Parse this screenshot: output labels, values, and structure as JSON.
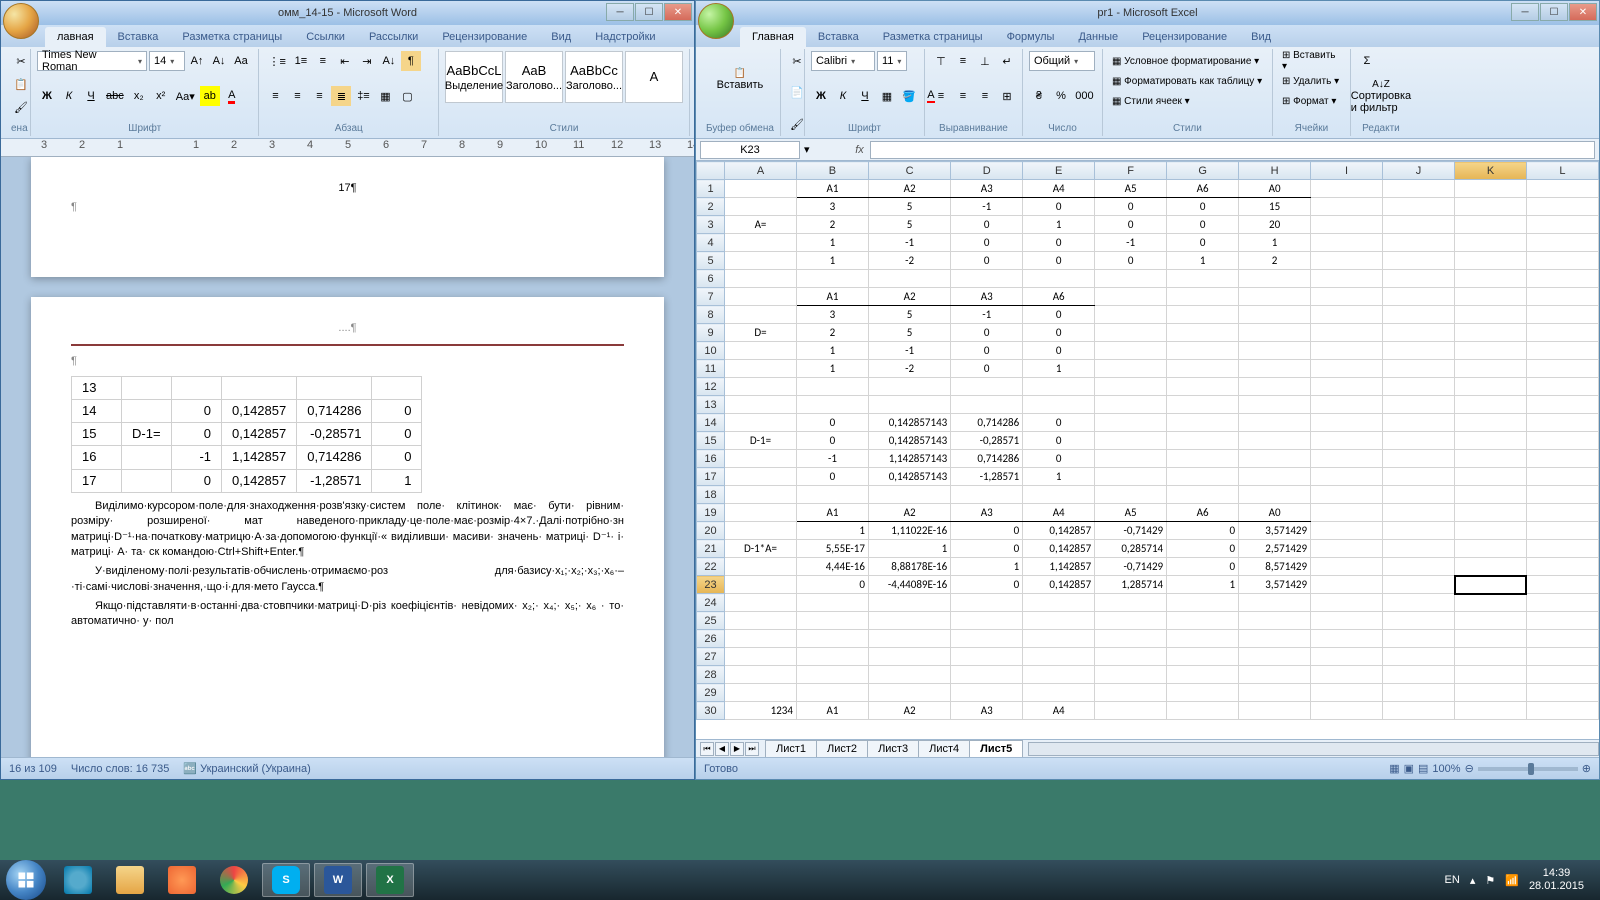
{
  "word": {
    "title": "омм_14-15 - Microsoft Word",
    "tabs": [
      "лавная",
      "Вставка",
      "Разметка страницы",
      "Ссылки",
      "Рассылки",
      "Рецензирование",
      "Вид",
      "Надстройки"
    ],
    "font_name": "Times New Roman",
    "font_size": "14",
    "groups": {
      "font": "Шрифт",
      "para": "Абзац",
      "styles": "Стили",
      "clip": "ена"
    },
    "style_boxes": [
      {
        "samp": "AaBbCcL",
        "label": "Выделение"
      },
      {
        "samp": "AaB",
        "label": "Заголово..."
      },
      {
        "samp": "AaBbCc",
        "label": "Заголово..."
      },
      {
        "samp": "A",
        "label": ""
      }
    ],
    "page_num": "17¶",
    "doc_table": {
      "rows": [
        [
          "13",
          "",
          "",
          "",
          "",
          ""
        ],
        [
          "14",
          "",
          "0",
          "0,142857",
          "0,714286",
          "0"
        ],
        [
          "15",
          "D-1=",
          "0",
          "0,142857",
          "-0,28571",
          "0"
        ],
        [
          "16",
          "",
          "-1",
          "1,142857",
          "0,714286",
          "0"
        ],
        [
          "17",
          "",
          "0",
          "0,142857",
          "-1,28571",
          "1"
        ]
      ]
    },
    "para1": "Виділимо·курсором·поле·для·знаходження·розв'язку·систем поле· клітинок· має· бути· рівним· розміру· розширеної· мат наведеного·прикладу·це·поле·має·розмір·4×7.·Далі·потрібно·зн матриці·D⁻¹·на·початкову·матрицю·A·за·допомогою·функції·« виділивши· масиви· значень· матриці· D⁻¹· і· матриці· A· та· ск командою·Ctrl+Shift+Enter.¶",
    "para2": "У·виділеному·полі·результатів·обчислень·отримаємо·роз для·базису·x₁;·x₂;·x₃;·x₆·–·ті·самі·числові·значення,·що·і·для·мето Гаусса.¶",
    "para3": "Якщо·підставляти·в·останні·два·стовпчики·матриці·D·різ коефіцієнтів· невідомих· x₂;· x₄;· x₅;· x₆ · то· автоматично· у· пол",
    "status": {
      "page": "16 из 109",
      "words": "Число слов: 16 735",
      "lang": "Украинский (Украина)"
    },
    "dots_line": "....¶"
  },
  "excel": {
    "title": "pr1 - Microsoft Excel",
    "tabs": [
      "Главная",
      "Вставка",
      "Разметка страницы",
      "Формулы",
      "Данные",
      "Рецензирование",
      "Вид"
    ],
    "font_name": "Calibri",
    "font_size": "11",
    "groups": {
      "clip": "Буфер обмена",
      "font": "Шрифт",
      "align": "Выравнивание",
      "num": "Число",
      "styles": "Стили",
      "cells": "Ячейки",
      "edit": "Редакти"
    },
    "num_format": "Общий",
    "pct": "%",
    "thou": "000",
    "style_btns": [
      "Условное форматирование",
      "Форматировать как таблицу",
      "Стили ячеек"
    ],
    "cell_btns": [
      "Вставить",
      "Удалить",
      "Формат"
    ],
    "sort_label": "Сортировка и фильтр",
    "paste": "Вставить",
    "namebox": "K23",
    "cols": [
      "A",
      "B",
      "C",
      "D",
      "E",
      "F",
      "G",
      "H",
      "I",
      "J",
      "K",
      "L"
    ],
    "sel_col": "K",
    "sel_row": 23,
    "rows": [
      {
        "r": 1,
        "cells": [
          "",
          "A1",
          "A2",
          "A3",
          "A4",
          "A5",
          "A6",
          "A0"
        ],
        "align": [
          "",
          "c",
          "c",
          "c",
          "c",
          "c",
          "c",
          "c"
        ],
        "bb": [
          1,
          2,
          3,
          4,
          5,
          6,
          7
        ]
      },
      {
        "r": 2,
        "cells": [
          "",
          "3",
          "5",
          "-1",
          "0",
          "0",
          "0",
          "15"
        ],
        "align": [
          "",
          "c",
          "c",
          "c",
          "c",
          "c",
          "c",
          "c"
        ]
      },
      {
        "r": 3,
        "cells": [
          "A=",
          "2",
          "5",
          "0",
          "1",
          "0",
          "0",
          "20"
        ],
        "align": [
          "c",
          "c",
          "c",
          "c",
          "c",
          "c",
          "c",
          "c"
        ]
      },
      {
        "r": 4,
        "cells": [
          "",
          "1",
          "-1",
          "0",
          "0",
          "-1",
          "0",
          "1"
        ],
        "align": [
          "",
          "c",
          "c",
          "c",
          "c",
          "c",
          "c",
          "c"
        ]
      },
      {
        "r": 5,
        "cells": [
          "",
          "1",
          "-2",
          "0",
          "0",
          "0",
          "1",
          "2"
        ],
        "align": [
          "",
          "c",
          "c",
          "c",
          "c",
          "c",
          "c",
          "c"
        ]
      },
      {
        "r": 6,
        "cells": [
          "",
          "",
          "",
          "",
          "",
          "",
          "",
          ""
        ]
      },
      {
        "r": 7,
        "cells": [
          "",
          "A1",
          "A2",
          "A3",
          "A6",
          "",
          "",
          ""
        ],
        "align": [
          "",
          "c",
          "c",
          "c",
          "c"
        ],
        "bb": [
          1,
          2,
          3,
          4
        ]
      },
      {
        "r": 8,
        "cells": [
          "",
          "3",
          "5",
          "-1",
          "0",
          "",
          "",
          ""
        ],
        "align": [
          "",
          "c",
          "c",
          "c",
          "c"
        ]
      },
      {
        "r": 9,
        "cells": [
          "D=",
          "2",
          "5",
          "0",
          "0",
          "",
          "",
          ""
        ],
        "align": [
          "c",
          "c",
          "c",
          "c",
          "c"
        ]
      },
      {
        "r": 10,
        "cells": [
          "",
          "1",
          "-1",
          "0",
          "0",
          "",
          "",
          ""
        ],
        "align": [
          "",
          "c",
          "c",
          "c",
          "c"
        ]
      },
      {
        "r": 11,
        "cells": [
          "",
          "1",
          "-2",
          "0",
          "1",
          "",
          "",
          ""
        ],
        "align": [
          "",
          "c",
          "c",
          "c",
          "c"
        ]
      },
      {
        "r": 12,
        "cells": [
          "",
          "",
          "",
          "",
          "",
          "",
          "",
          ""
        ]
      },
      {
        "r": 13,
        "cells": [
          "",
          "",
          "",
          "",
          "",
          "",
          "",
          ""
        ]
      },
      {
        "r": 14,
        "cells": [
          "",
          "0",
          "0,142857143",
          "0,714286",
          "0",
          "",
          "",
          ""
        ],
        "align": [
          "",
          "c",
          "r",
          "r",
          "c"
        ]
      },
      {
        "r": 15,
        "cells": [
          "D-1=",
          "0",
          "0,142857143",
          "-0,28571",
          "0",
          "",
          "",
          ""
        ],
        "align": [
          "c",
          "c",
          "r",
          "r",
          "c"
        ]
      },
      {
        "r": 16,
        "cells": [
          "",
          "-1",
          "1,142857143",
          "0,714286",
          "0",
          "",
          "",
          ""
        ],
        "align": [
          "",
          "c",
          "r",
          "r",
          "c"
        ]
      },
      {
        "r": 17,
        "cells": [
          "",
          "0",
          "0,142857143",
          "-1,28571",
          "1",
          "",
          "",
          ""
        ],
        "align": [
          "",
          "c",
          "r",
          "r",
          "c"
        ]
      },
      {
        "r": 18,
        "cells": [
          "",
          "",
          "",
          "",
          "",
          "",
          "",
          ""
        ]
      },
      {
        "r": 19,
        "cells": [
          "",
          "A1",
          "A2",
          "A3",
          "A4",
          "A5",
          "A6",
          "A0"
        ],
        "align": [
          "",
          "c",
          "c",
          "c",
          "c",
          "c",
          "c",
          "c"
        ],
        "bb": [
          1,
          2,
          3,
          4,
          5,
          6,
          7
        ]
      },
      {
        "r": 20,
        "cells": [
          "",
          "1",
          "1,11022E-16",
          "0",
          "0,142857",
          "-0,71429",
          "0",
          "3,571429"
        ]
      },
      {
        "r": 21,
        "cells": [
          "D-1*A=",
          "5,55E-17",
          "1",
          "0",
          "0,142857",
          "0,285714",
          "0",
          "2,571429"
        ],
        "align": [
          "c"
        ]
      },
      {
        "r": 22,
        "cells": [
          "",
          "4,44E-16",
          "8,88178E-16",
          "1",
          "1,142857",
          "-0,71429",
          "0",
          "8,571429"
        ]
      },
      {
        "r": 23,
        "cells": [
          "",
          "0",
          "-4,44089E-16",
          "0",
          "0,142857",
          "1,285714",
          "1",
          "3,571429"
        ]
      },
      {
        "r": 24,
        "cells": [
          "",
          "",
          "",
          "",
          "",
          "",
          "",
          ""
        ]
      },
      {
        "r": 25,
        "cells": [
          "",
          "",
          "",
          "",
          "",
          "",
          "",
          ""
        ]
      },
      {
        "r": 26,
        "cells": [
          "",
          "",
          "",
          "",
          "",
          "",
          "",
          ""
        ]
      },
      {
        "r": 27,
        "cells": [
          "",
          "",
          "",
          "",
          "",
          "",
          "",
          ""
        ]
      },
      {
        "r": 28,
        "cells": [
          "",
          "",
          "",
          "",
          "",
          "",
          "",
          ""
        ]
      },
      {
        "r": 29,
        "cells": [
          "",
          "",
          "",
          "",
          "",
          "",
          "",
          ""
        ]
      },
      {
        "r": 30,
        "cells": [
          "1234",
          "A1",
          "A2",
          "A3",
          "A4",
          "",
          "",
          ""
        ],
        "align": [
          "r",
          "c",
          "c",
          "c",
          "c"
        ]
      }
    ],
    "sheets": [
      "Лист1",
      "Лист2",
      "Лист3",
      "Лист4",
      "Лист5"
    ],
    "active_sheet": "Лист5",
    "status": "Готово",
    "zoom": "100%"
  },
  "taskbar": {
    "lang": "EN",
    "time": "14:39",
    "date": "28.01.2015"
  }
}
